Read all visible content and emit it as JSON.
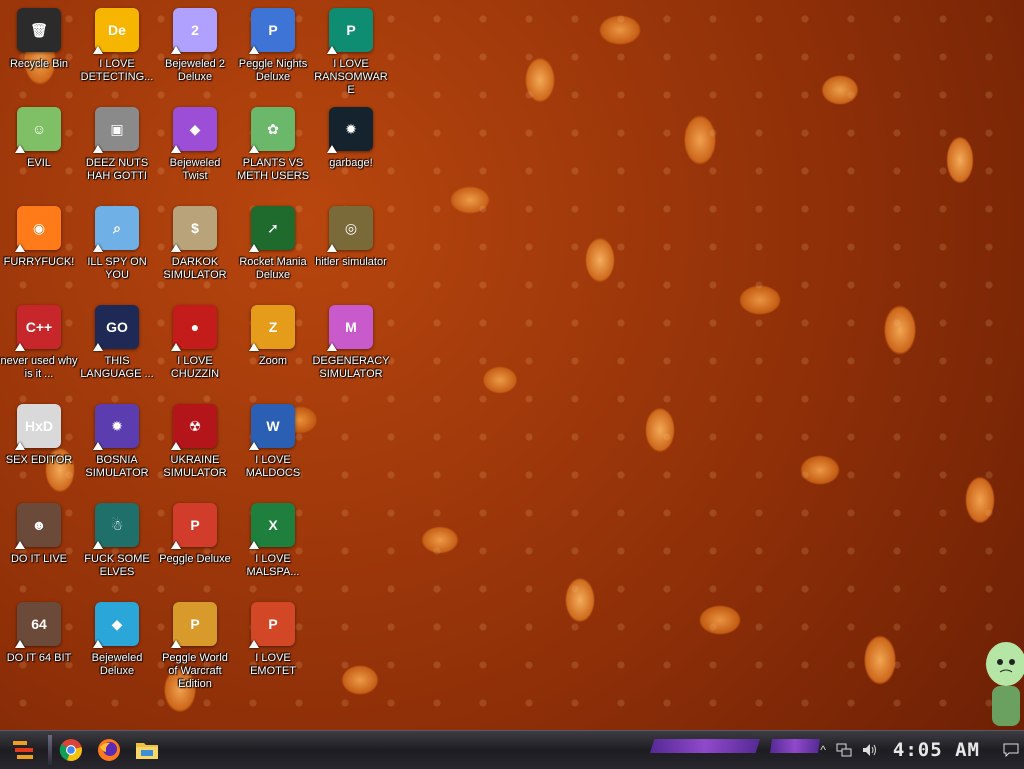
{
  "desktop": {
    "icons": [
      {
        "label": "Recycle Bin",
        "glyph": "🗑",
        "bg": "#2b2b2b"
      },
      {
        "label": "I LOVE DETECTING...",
        "glyph": "De",
        "bg": "#f5b500"
      },
      {
        "label": "Bejeweled 2 Deluxe",
        "glyph": "2",
        "bg": "#b0a0ff"
      },
      {
        "label": "Peggle Nights Deluxe",
        "glyph": "P",
        "bg": "#3d74d6"
      },
      {
        "label": "I LOVE RANSOMWARE",
        "glyph": "P",
        "bg": "#0f8d72"
      },
      {
        "label": "EVIL",
        "glyph": "☺",
        "bg": "#7fbf66"
      },
      {
        "label": "DEEZ NUTS HAH GOTTI",
        "glyph": "▣",
        "bg": "#8a8a8a"
      },
      {
        "label": "Bejeweled Twist",
        "glyph": "◆",
        "bg": "#9c4ed6"
      },
      {
        "label": "PLANTS VS METH USERS",
        "glyph": "✿",
        "bg": "#6bb86a"
      },
      {
        "label": "garbage!",
        "glyph": "✹",
        "bg": "#15232e"
      },
      {
        "label": "FURRYFUCK!",
        "glyph": "◉",
        "bg": "#ff7a18"
      },
      {
        "label": "ILL SPY ON YOU",
        "glyph": "⌕",
        "bg": "#6fb0e6"
      },
      {
        "label": "DARKOK SIMULATOR",
        "glyph": "$",
        "bg": "#b8a37a"
      },
      {
        "label": "Rocket Mania Deluxe",
        "glyph": "➚",
        "bg": "#1f6b2e"
      },
      {
        "label": "hitler simulator",
        "glyph": "◎",
        "bg": "#7a6a3a"
      },
      {
        "label": "never used why is it ...",
        "glyph": "C++",
        "bg": "#c7262b"
      },
      {
        "label": "THIS LANGUAGE ...",
        "glyph": "GO",
        "bg": "#1e2a55"
      },
      {
        "label": "I LOVE CHUZZIN",
        "glyph": "●",
        "bg": "#c41b1b"
      },
      {
        "label": "Zoom",
        "glyph": "Z",
        "bg": "#e59c1a"
      },
      {
        "label": "DEGENERACY SIMULATOR",
        "glyph": "M",
        "bg": "#c85acc"
      },
      {
        "label": "SEX EDITOR",
        "glyph": "HxD",
        "bg": "#d9d9d9"
      },
      {
        "label": "BOSNIA SIMULATOR",
        "glyph": "✹",
        "bg": "#5b3db0"
      },
      {
        "label": "UKRAINE SIMULATOR",
        "glyph": "☢",
        "bg": "#b3151b"
      },
      {
        "label": "I LOVE MALDOCS",
        "glyph": "W",
        "bg": "#2b5fb4"
      },
      {
        "label": "DO IT LIVE",
        "glyph": "☻",
        "bg": "#6b4a3a"
      },
      {
        "label": "FUCK SOME ELVES",
        "glyph": "☃",
        "bg": "#1f6f6a"
      },
      {
        "label": "Peggle Deluxe",
        "glyph": "P",
        "bg": "#d13c2b"
      },
      {
        "label": "I LOVE MALSPA...",
        "glyph": "X",
        "bg": "#1f7f3c"
      },
      {
        "label": "DO IT 64 BIT",
        "glyph": "64",
        "bg": "#6b4a3a"
      },
      {
        "label": "Bejeweled Deluxe",
        "glyph": "◆",
        "bg": "#2aa6d8"
      },
      {
        "label": "Peggle World of Warcraft Edition",
        "glyph": "P",
        "bg": "#d89a2a"
      },
      {
        "label": "I LOVE EMOTET",
        "glyph": "P",
        "bg": "#d24726"
      }
    ]
  },
  "taskbar": {
    "start_glyph": "≡",
    "apps": [
      {
        "name": "Google Chrome",
        "glyph": "◉",
        "color": "#2e9e3f"
      },
      {
        "name": "Firefox",
        "glyph": "●",
        "color": "#ff6a1a"
      },
      {
        "name": "File Explorer",
        "glyph": "▭",
        "color": "#f0c040"
      }
    ],
    "tray": {
      "chevron": "^",
      "network_glyph": "⊟",
      "volume_glyph": "🔈",
      "time": "4:05 AM",
      "notification_glyph": "▭"
    }
  }
}
